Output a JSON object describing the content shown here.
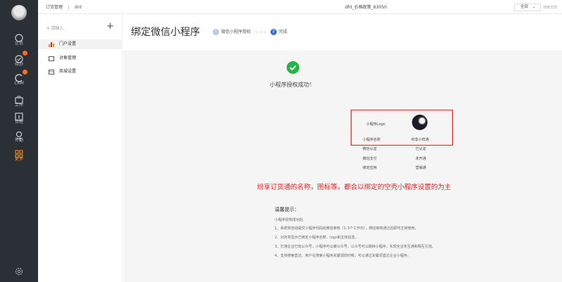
{
  "topbar": {
    "crumbs": [
      "订货管理",
      "dnt"
    ],
    "center_title": "dht_价格政策_83050",
    "scope_label": "全部",
    "search_placeholder": "搜索全部"
  },
  "rail": {
    "items": [
      {
        "label": "企信",
        "icon": "chat-icon",
        "badge": false
      },
      {
        "label": "待办",
        "icon": "todo-icon",
        "badge": true
      },
      {
        "label": "CRM",
        "icon": "crm-icon",
        "badge": true
      },
      {
        "label": "工作",
        "icon": "work-icon",
        "badge": false
      },
      {
        "label": "日程",
        "icon": "calendar-icon",
        "badge": false
      },
      {
        "label": "外勤",
        "icon": "location-icon",
        "badge": false
      },
      {
        "label": "更多",
        "icon": "grid-icon",
        "badge": false
      }
    ],
    "accent": "#f08a24"
  },
  "sidebar": {
    "search_placeholder": "请输入",
    "items": [
      {
        "label": "门户设置",
        "icon": "bar-chart-icon",
        "active": true
      },
      {
        "label": "对象管理",
        "icon": "folder-icon",
        "active": false
      },
      {
        "label": "商城设置",
        "icon": "store-icon",
        "active": false
      }
    ]
  },
  "main": {
    "title": "绑定微信小程序",
    "steps": [
      {
        "num": "1",
        "label": "微信小程序授权"
      },
      {
        "num": "2",
        "label": "完成"
      }
    ],
    "success_text": "小程序授权成功！",
    "info": {
      "logo_label": "小程序Logo",
      "rows": [
        {
          "label": "小程序名称",
          "value": "纷享小样通"
        },
        {
          "label": "微信认证",
          "value": "已认证"
        },
        {
          "label": "微信支付",
          "value": "未开通"
        },
        {
          "label": "绑定应用",
          "value": "营销通"
        }
      ]
    },
    "annotation": "纷享订货通的名称，图标等，都会以绑定的空壳小程序设置的为主",
    "tips": {
      "title": "温馨提示：",
      "lines": [
        "小程序授权成功后",
        "1、系统将自动提交小程序代码给微信审核（1-3个工作日），微信审核通过后即可正常使用。",
        "2、对外将显示已绑定小程序名称、logo和主体信息。",
        "3、打通企业已有公众号，小程序可以被公众号，公众号可以跳转小程序，实现全业务互通和相互引流。",
        "4、支持搜索直达，用户在搜索小程序关键词的时候，可以通过关键词直达企业小程序。"
      ]
    }
  },
  "colors": {
    "rail_bg": "#2b2f36",
    "success_green": "#27b24a",
    "highlight_red": "#e0201f",
    "step_blue": "#3b6fd8"
  }
}
